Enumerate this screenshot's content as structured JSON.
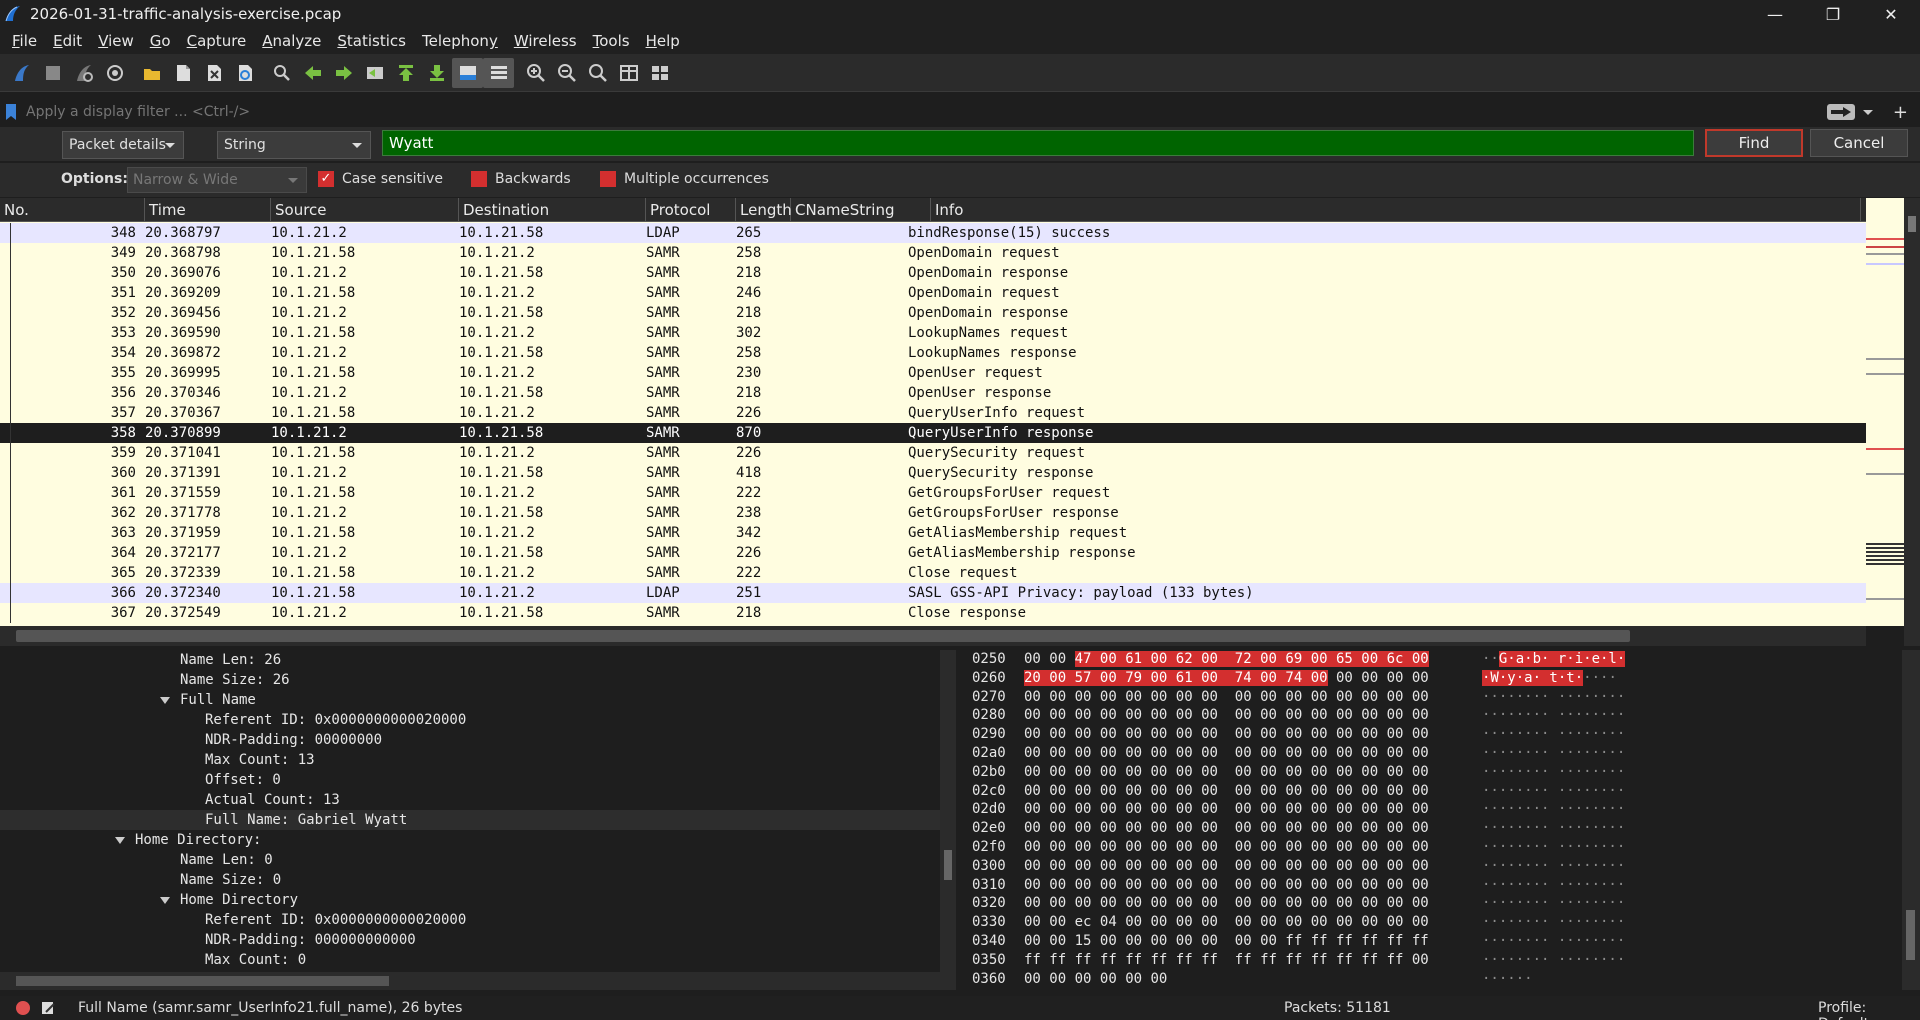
{
  "window": {
    "title": "2026-01-31-traffic-analysis-exercise.pcap"
  },
  "menu": [
    {
      "label": "File",
      "key": "F"
    },
    {
      "label": "Edit",
      "key": "E"
    },
    {
      "label": "View",
      "key": "V"
    },
    {
      "label": "Go",
      "key": "G"
    },
    {
      "label": "Capture",
      "key": "C"
    },
    {
      "label": "Analyze",
      "key": "A"
    },
    {
      "label": "Statistics",
      "key": "S"
    },
    {
      "label": "Telephony",
      "key": "y"
    },
    {
      "label": "Wireless",
      "key": "W"
    },
    {
      "label": "Tools",
      "key": "T"
    },
    {
      "label": "Help",
      "key": "H"
    }
  ],
  "filter": {
    "placeholder": "Apply a display filter ... <Ctrl-/>"
  },
  "find": {
    "search_in": "Packet details",
    "search_type": "String",
    "value": "Wyatt",
    "find_label": "Find",
    "cancel_label": "Cancel"
  },
  "options": {
    "label": "Options:",
    "charset": "Narrow & Wide",
    "case_sensitive": "Case sensitive",
    "backwards": "Backwards",
    "multiple": "Multiple occurrences"
  },
  "packet_list": {
    "columns": [
      "No.",
      "Time",
      "Source",
      "Destination",
      "Protocol",
      "Length",
      "CNameString",
      "Info"
    ],
    "rows": [
      [
        "348",
        "20.368797",
        "10.1.21.2",
        "10.1.21.58",
        "LDAP",
        "265",
        "bindResponse(15) success"
      ],
      [
        "349",
        "20.368798",
        "10.1.21.58",
        "10.1.21.2",
        "SAMR",
        "258",
        "OpenDomain request"
      ],
      [
        "350",
        "20.369076",
        "10.1.21.2",
        "10.1.21.58",
        "SAMR",
        "218",
        "OpenDomain response"
      ],
      [
        "351",
        "20.369209",
        "10.1.21.58",
        "10.1.21.2",
        "SAMR",
        "246",
        "OpenDomain request"
      ],
      [
        "352",
        "20.369456",
        "10.1.21.2",
        "10.1.21.58",
        "SAMR",
        "218",
        "OpenDomain response"
      ],
      [
        "353",
        "20.369590",
        "10.1.21.58",
        "10.1.21.2",
        "SAMR",
        "302",
        "LookupNames request"
      ],
      [
        "354",
        "20.369872",
        "10.1.21.2",
        "10.1.21.58",
        "SAMR",
        "258",
        "LookupNames response"
      ],
      [
        "355",
        "20.369995",
        "10.1.21.58",
        "10.1.21.2",
        "SAMR",
        "230",
        "OpenUser request"
      ],
      [
        "356",
        "20.370346",
        "10.1.21.2",
        "10.1.21.58",
        "SAMR",
        "218",
        "OpenUser response"
      ],
      [
        "357",
        "20.370367",
        "10.1.21.58",
        "10.1.21.2",
        "SAMR",
        "226",
        "QueryUserInfo request"
      ],
      [
        "358",
        "20.370899",
        "10.1.21.2",
        "10.1.21.58",
        "SAMR",
        "870",
        "QueryUserInfo response"
      ],
      [
        "359",
        "20.371041",
        "10.1.21.58",
        "10.1.21.2",
        "SAMR",
        "226",
        "QuerySecurity request"
      ],
      [
        "360",
        "20.371391",
        "10.1.21.2",
        "10.1.21.58",
        "SAMR",
        "418",
        "QuerySecurity response"
      ],
      [
        "361",
        "20.371559",
        "10.1.21.58",
        "10.1.21.2",
        "SAMR",
        "222",
        "GetGroupsForUser request"
      ],
      [
        "362",
        "20.371778",
        "10.1.21.2",
        "10.1.21.58",
        "SAMR",
        "238",
        "GetGroupsForUser response"
      ],
      [
        "363",
        "20.371959",
        "10.1.21.58",
        "10.1.21.2",
        "SAMR",
        "342",
        "GetAliasMembership request"
      ],
      [
        "364",
        "20.372177",
        "10.1.21.2",
        "10.1.21.58",
        "SAMR",
        "226",
        "GetAliasMembership response"
      ],
      [
        "365",
        "20.372339",
        "10.1.21.58",
        "10.1.21.2",
        "SAMR",
        "222",
        "Close request"
      ],
      [
        "366",
        "20.372340",
        "10.1.21.58",
        "10.1.21.2",
        "LDAP",
        "251",
        "SASL GSS-API Privacy: payload (133 bytes)"
      ],
      [
        "367",
        "20.372549",
        "10.1.21.2",
        "10.1.21.58",
        "SAMR",
        "218",
        "Close response"
      ]
    ],
    "selected_no": "358"
  },
  "details": [
    {
      "indent": 0,
      "text": "Name Len: 26"
    },
    {
      "indent": 0,
      "text": "Name Size: 26"
    },
    {
      "indent": 0,
      "text": "Full Name",
      "expanded": true
    },
    {
      "indent": 1,
      "text": "Referent ID: 0x0000000000020000"
    },
    {
      "indent": 1,
      "text": "NDR-Padding: 00000000"
    },
    {
      "indent": 1,
      "text": "Max Count: 13"
    },
    {
      "indent": 1,
      "text": "Offset: 0"
    },
    {
      "indent": 1,
      "text": "Actual Count: 13"
    },
    {
      "indent": 1,
      "text": "Full Name: Gabriel Wyatt",
      "selected": true
    },
    {
      "indent": -1,
      "text": "Home Directory:",
      "expanded": true
    },
    {
      "indent": 0,
      "text": "Name Len: 0"
    },
    {
      "indent": 0,
      "text": "Name Size: 0"
    },
    {
      "indent": 0,
      "text": "Home Directory",
      "expanded": true
    },
    {
      "indent": 1,
      "text": "Referent ID: 0x0000000000020000"
    },
    {
      "indent": 1,
      "text": "NDR-Padding: 000000000000"
    },
    {
      "indent": 1,
      "text": "Max Count: 0"
    }
  ],
  "bytes": [
    {
      "off": "0250",
      "hex": [
        "00",
        "00",
        "47",
        "00",
        "61",
        "00",
        "62",
        "00",
        "72",
        "00",
        "69",
        "00",
        "65",
        "00",
        "6c",
        "00"
      ],
      "ascii": "··G·a·b· r·i·e·l·",
      "hl_from": 2
    },
    {
      "off": "0260",
      "hex": [
        "20",
        "00",
        "57",
        "00",
        "79",
        "00",
        "61",
        "00",
        "74",
        "00",
        "74",
        "00",
        "00",
        "00",
        "00",
        "00"
      ],
      "ascii": "·W·y·a· t·t·····",
      "hl_to": 12
    },
    {
      "off": "0270",
      "hex": [
        "00",
        "00",
        "00",
        "00",
        "00",
        "00",
        "00",
        "00",
        "00",
        "00",
        "00",
        "00",
        "00",
        "00",
        "00",
        "00"
      ],
      "ascii": "········ ········"
    },
    {
      "off": "0280",
      "hex": [
        "00",
        "00",
        "00",
        "00",
        "00",
        "00",
        "00",
        "00",
        "00",
        "00",
        "00",
        "00",
        "00",
        "00",
        "00",
        "00"
      ],
      "ascii": "········ ········"
    },
    {
      "off": "0290",
      "hex": [
        "00",
        "00",
        "00",
        "00",
        "00",
        "00",
        "00",
        "00",
        "00",
        "00",
        "00",
        "00",
        "00",
        "00",
        "00",
        "00"
      ],
      "ascii": "········ ········"
    },
    {
      "off": "02a0",
      "hex": [
        "00",
        "00",
        "00",
        "00",
        "00",
        "00",
        "00",
        "00",
        "00",
        "00",
        "00",
        "00",
        "00",
        "00",
        "00",
        "00"
      ],
      "ascii": "········ ········"
    },
    {
      "off": "02b0",
      "hex": [
        "00",
        "00",
        "00",
        "00",
        "00",
        "00",
        "00",
        "00",
        "00",
        "00",
        "00",
        "00",
        "00",
        "00",
        "00",
        "00"
      ],
      "ascii": "········ ········"
    },
    {
      "off": "02c0",
      "hex": [
        "00",
        "00",
        "00",
        "00",
        "00",
        "00",
        "00",
        "00",
        "00",
        "00",
        "00",
        "00",
        "00",
        "00",
        "00",
        "00"
      ],
      "ascii": "········ ········"
    },
    {
      "off": "02d0",
      "hex": [
        "00",
        "00",
        "00",
        "00",
        "00",
        "00",
        "00",
        "00",
        "00",
        "00",
        "00",
        "00",
        "00",
        "00",
        "00",
        "00"
      ],
      "ascii": "········ ········"
    },
    {
      "off": "02e0",
      "hex": [
        "00",
        "00",
        "00",
        "00",
        "00",
        "00",
        "00",
        "00",
        "00",
        "00",
        "00",
        "00",
        "00",
        "00",
        "00",
        "00"
      ],
      "ascii": "········ ········"
    },
    {
      "off": "02f0",
      "hex": [
        "00",
        "00",
        "00",
        "00",
        "00",
        "00",
        "00",
        "00",
        "00",
        "00",
        "00",
        "00",
        "00",
        "00",
        "00",
        "00"
      ],
      "ascii": "········ ········"
    },
    {
      "off": "0300",
      "hex": [
        "00",
        "00",
        "00",
        "00",
        "00",
        "00",
        "00",
        "00",
        "00",
        "00",
        "00",
        "00",
        "00",
        "00",
        "00",
        "00"
      ],
      "ascii": "········ ········"
    },
    {
      "off": "0310",
      "hex": [
        "00",
        "00",
        "00",
        "00",
        "00",
        "00",
        "00",
        "00",
        "00",
        "00",
        "00",
        "00",
        "00",
        "00",
        "00",
        "00"
      ],
      "ascii": "········ ········"
    },
    {
      "off": "0320",
      "hex": [
        "00",
        "00",
        "00",
        "00",
        "00",
        "00",
        "00",
        "00",
        "00",
        "00",
        "00",
        "00",
        "00",
        "00",
        "00",
        "00"
      ],
      "ascii": "········ ········"
    },
    {
      "off": "0330",
      "hex": [
        "00",
        "00",
        "ec",
        "04",
        "00",
        "00",
        "00",
        "00",
        "00",
        "00",
        "00",
        "00",
        "00",
        "00",
        "00",
        "00"
      ],
      "ascii": "········ ········"
    },
    {
      "off": "0340",
      "hex": [
        "00",
        "00",
        "15",
        "00",
        "00",
        "00",
        "00",
        "00",
        "00",
        "00",
        "ff",
        "ff",
        "ff",
        "ff",
        "ff",
        "ff"
      ],
      "ascii": "········ ········"
    },
    {
      "off": "0350",
      "hex": [
        "ff",
        "ff",
        "ff",
        "ff",
        "ff",
        "ff",
        "ff",
        "ff",
        "ff",
        "ff",
        "ff",
        "ff",
        "ff",
        "ff",
        "ff",
        "00"
      ],
      "ascii": "········ ········"
    },
    {
      "off": "0360",
      "hex": [
        "00",
        "00",
        "00",
        "00",
        "00",
        "00"
      ],
      "ascii": "······"
    }
  ],
  "status": {
    "field": "Full Name (samr.samr_UserInfo21.full_name), 26 bytes",
    "packets": "Packets: 51181",
    "profile": "Profile: Default"
  },
  "colors": {
    "samr_row": "#fffde0",
    "ldap_row": "#e7e6ff",
    "find_field": "#006400",
    "highlight": "#d32f2f"
  }
}
